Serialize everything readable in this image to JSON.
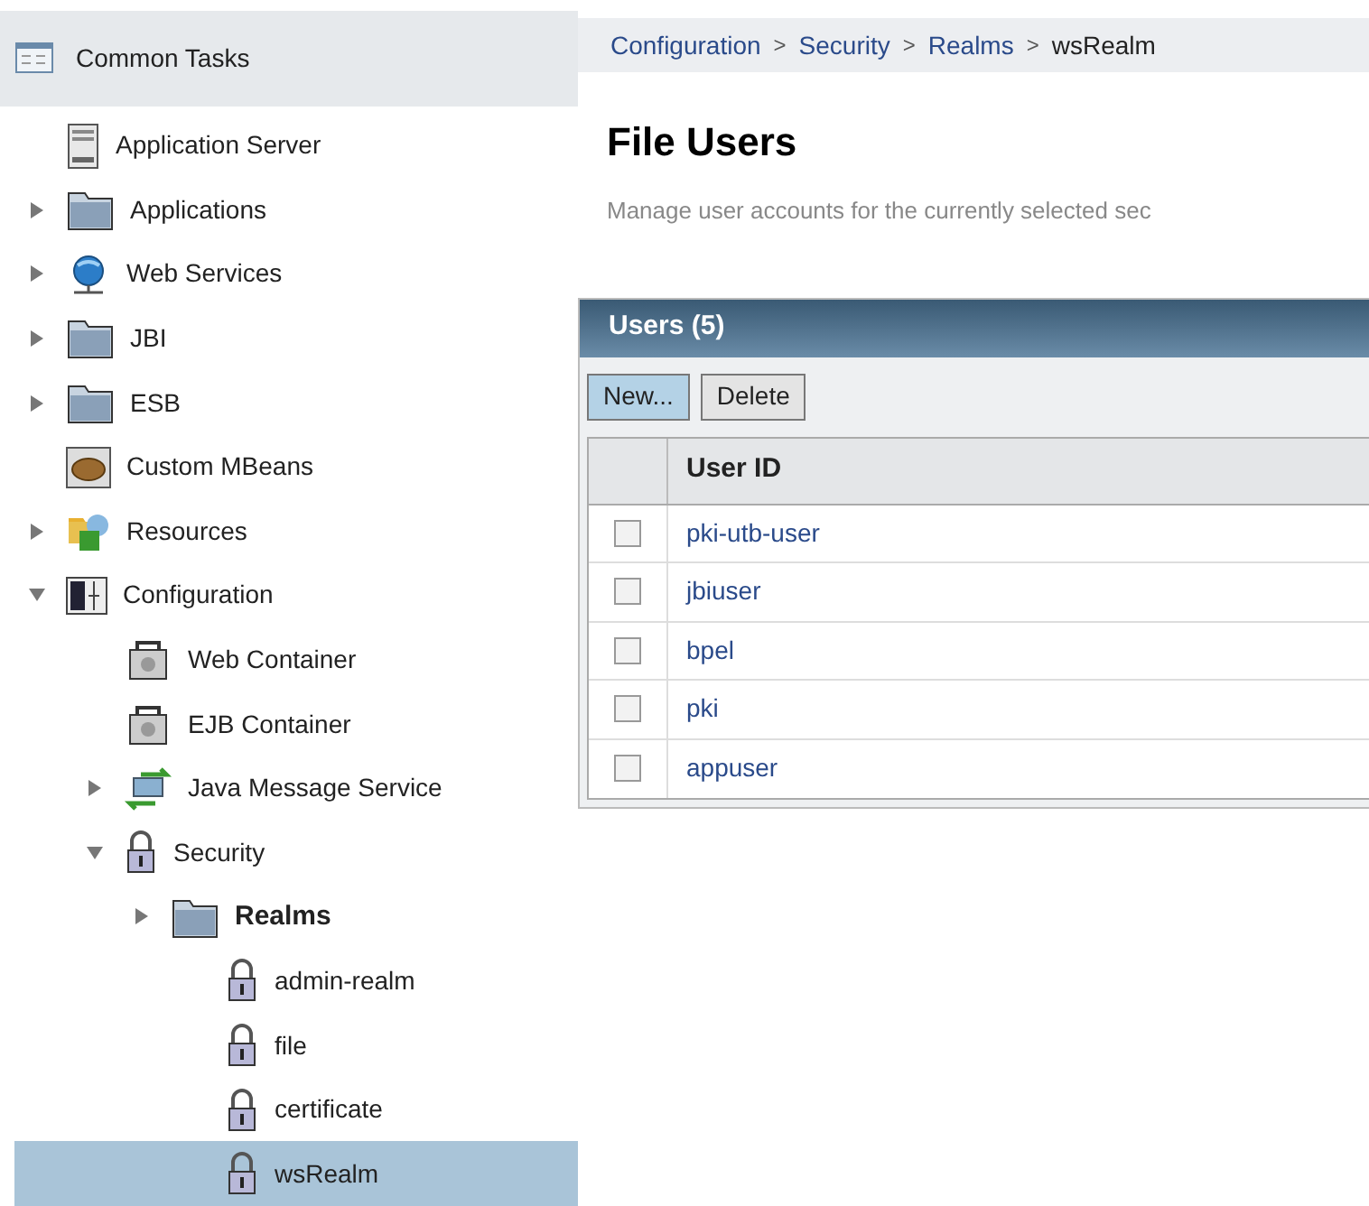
{
  "sidebar": {
    "header": "Common Tasks",
    "tree": [
      {
        "label": "Application Server",
        "kind": "server",
        "selected": false,
        "emphasized": false
      },
      {
        "label": "Applications",
        "kind": "folder",
        "expanded": false,
        "selected": false,
        "emphasized": false
      },
      {
        "label": "Web Services",
        "kind": "globe",
        "expanded": false,
        "selected": false,
        "emphasized": false
      },
      {
        "label": "JBI",
        "kind": "folder",
        "expanded": false,
        "selected": false,
        "emphasized": false
      },
      {
        "label": "ESB",
        "kind": "folder",
        "expanded": false,
        "selected": false,
        "emphasized": false
      },
      {
        "label": "Custom MBeans",
        "kind": "bean",
        "selected": false,
        "emphasized": false
      },
      {
        "label": "Resources",
        "kind": "resources",
        "expanded": false,
        "selected": false,
        "emphasized": false
      },
      {
        "label": "Configuration",
        "kind": "config",
        "expanded": true,
        "selected": false,
        "emphasized": false,
        "children": [
          {
            "label": "Web Container",
            "kind": "container",
            "selected": false,
            "emphasized": false
          },
          {
            "label": "EJB Container",
            "kind": "container",
            "selected": false,
            "emphasized": false
          },
          {
            "label": "Java Message Service",
            "kind": "jms",
            "expanded": false,
            "selected": false,
            "emphasized": false
          },
          {
            "label": "Security",
            "kind": "lock",
            "expanded": true,
            "selected": false,
            "emphasized": false,
            "children": [
              {
                "label": "Realms",
                "kind": "folder",
                "expanded": false,
                "selected": false,
                "emphasized": true,
                "children": [
                  {
                    "label": "admin-realm",
                    "kind": "lock",
                    "selected": false,
                    "emphasized": false
                  },
                  {
                    "label": "file",
                    "kind": "lock",
                    "selected": false,
                    "emphasized": false
                  },
                  {
                    "label": "certificate",
                    "kind": "lock",
                    "selected": false,
                    "emphasized": false
                  },
                  {
                    "label": "wsRealm",
                    "kind": "lock",
                    "selected": true,
                    "emphasized": false
                  }
                ]
              }
            ]
          }
        ]
      }
    ]
  },
  "breadcrumb": {
    "items": [
      "Configuration",
      "Security",
      "Realms"
    ],
    "separator": ">",
    "current": "wsRealm"
  },
  "page": {
    "title": "File Users",
    "description": "Manage user accounts for the currently selected sec"
  },
  "table": {
    "title": "Users (5)",
    "buttons": [
      {
        "label": "New...",
        "selected": true
      },
      {
        "label": "Delete",
        "selected": false
      }
    ],
    "columns": [
      "User ID"
    ],
    "rows": [
      {
        "user_id": "pki-utb-user",
        "checked": false
      },
      {
        "user_id": "jbiuser",
        "checked": false
      },
      {
        "user_id": "bpel",
        "checked": false
      },
      {
        "user_id": "pki",
        "checked": false
      },
      {
        "user_id": "appuser",
        "checked": false
      }
    ]
  }
}
